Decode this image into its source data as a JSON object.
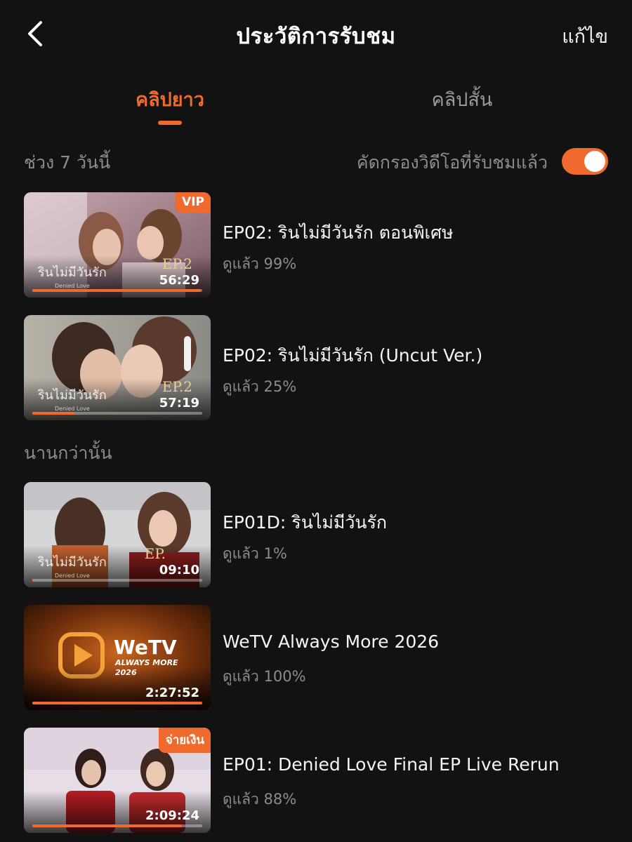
{
  "header": {
    "title": "ประวัติการรับชม",
    "edit_label": "แก้ไข",
    "back_icon": "chevron-left-icon"
  },
  "tabs": [
    {
      "label": "คลิปยาว",
      "active": true
    },
    {
      "label": "คลิปสั้น",
      "active": false
    }
  ],
  "filter": {
    "period_label": "ช่วง 7 วันนี้",
    "toggle_label": "คัดกรองวิดีโอที่รับชมแล้ว",
    "toggle_on": true
  },
  "sections": {
    "older_label": "นานกว่านั้น"
  },
  "items": [
    {
      "title": "EP02: รินไม่มีวันรัก ตอนพิเศษ",
      "progress_text": "ดูแล้ว 99%",
      "progress": 0.99,
      "duration": "56:29",
      "badge": "VIP",
      "thumb_logo": "รินไม่มีวันรัก",
      "thumb_logo_sub": "Denied Love",
      "thumb_ep": "EP.2"
    },
    {
      "title": "EP02: รินไม่มีวันรัก (Uncut Ver.)",
      "progress_text": "ดูแล้ว 25%",
      "progress": 0.25,
      "duration": "57:19",
      "badge": "",
      "thumb_logo": "รินไม่มีวันรัก",
      "thumb_logo_sub": "Denied Love",
      "thumb_ep": "EP.2"
    },
    {
      "title": "EP01D: รินไม่มีวันรัก",
      "progress_text": "ดูแล้ว 1%",
      "progress": 0.01,
      "duration": "09:10",
      "badge": "",
      "thumb_logo": "รินไม่มีวันรัก",
      "thumb_logo_sub": "Denied Love",
      "thumb_ep": "EP."
    },
    {
      "title": "WeTV Always More 2026",
      "progress_text": "ดูแล้ว 100%",
      "progress": 1.0,
      "duration": "2:27:52",
      "badge": "",
      "thumb_wetv": "WeTV",
      "thumb_wetv_tag": "ALWAYS MORE",
      "thumb_wetv_year": "2026"
    },
    {
      "title": "EP01: Denied Love Final EP Live Rerun",
      "progress_text": "ดูแล้ว 88%",
      "progress": 0.88,
      "duration": "2:09:24",
      "badge": "จ่ายเงิน"
    }
  ],
  "colors": {
    "accent": "#ef6a2c",
    "background": "#121212",
    "muted_text": "#8c8c8c"
  }
}
